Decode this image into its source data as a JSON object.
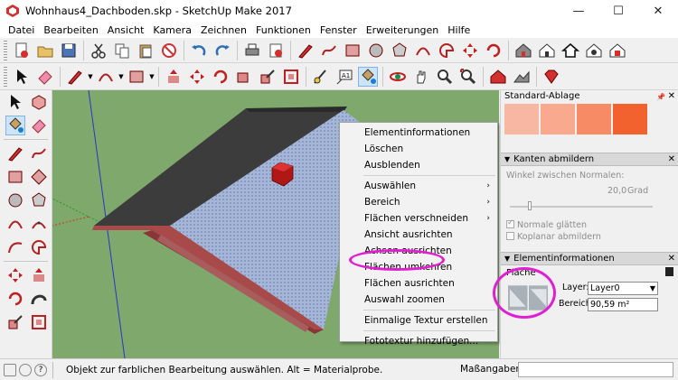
{
  "window": {
    "title": "Wohnhaus4_Dachboden.skp - SketchUp Make 2017",
    "minimize": "—",
    "maximize": "☐",
    "close": "✕"
  },
  "menu": [
    "Datei",
    "Bearbeiten",
    "Ansicht",
    "Kamera",
    "Zeichnen",
    "Funktionen",
    "Fenster",
    "Erweiterungen",
    "Hilfe"
  ],
  "context_menu": {
    "items": [
      {
        "label": "Elementinformationen"
      },
      {
        "label": "Löschen"
      },
      {
        "label": "Ausblenden"
      },
      {
        "label": "Auswählen",
        "submenu": "›"
      },
      {
        "label": "Bereich",
        "submenu": "›"
      },
      {
        "label": "Flächen verschneiden",
        "submenu": "›"
      },
      {
        "label": "Ansicht ausrichten"
      },
      {
        "label": "Achsen ausrichten"
      },
      {
        "label": "Flächen umkehren"
      },
      {
        "label": "Flächen ausrichten"
      },
      {
        "label": "Auswahl zoomen"
      },
      {
        "label": "Einmalige Textur erstellen"
      },
      {
        "label": "Fototextur hinzufügen..."
      }
    ],
    "highlighted_item": "Flächen umkehren"
  },
  "tray": {
    "title": "Standard-Ablage",
    "swatch_colors": [
      "#f7b7a3",
      "#f9a98e",
      "#f68b66",
      "#f2622f"
    ],
    "soften_panel": {
      "title": "Kanten abmildern",
      "angle_label": "Winkel zwischen Normalen:",
      "angle_value": "20,0",
      "angle_unit": "Grad",
      "smooth_normals": "Normale glätten",
      "soften_coplanar": "Koplanar abmildern"
    },
    "entity_panel": {
      "title": "Elementinformationen",
      "type": "Fläche",
      "layer_label": "Layer:",
      "layer_value": "Layer0",
      "area_label": "Bereich:",
      "area_value": "90,59 m²"
    }
  },
  "status": {
    "message": "Objekt zur farblichen Bearbeitung auswählen. Alt = Materialprobe.",
    "measurements_label": "Maßangaben",
    "measurements_value": ""
  },
  "colors": {
    "viewport_bg": "#7fa86c",
    "highlight": "#e020d0",
    "roof": "#3c3c3c",
    "wall_brick": "#a84a4a"
  }
}
